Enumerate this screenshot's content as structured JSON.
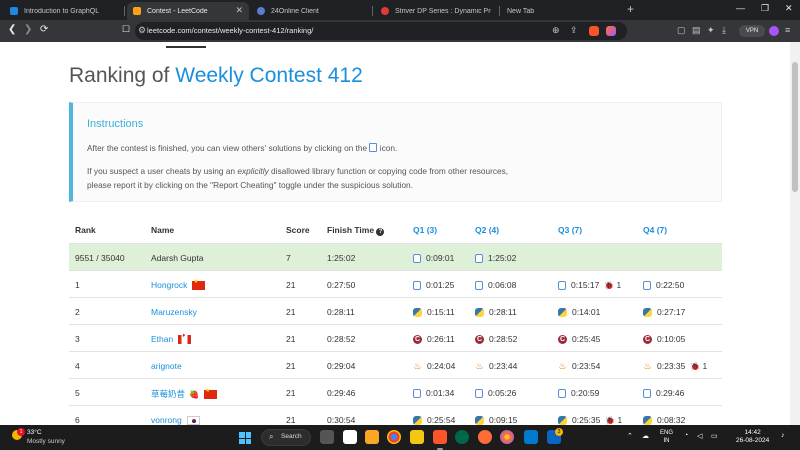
{
  "browser": {
    "tabs": [
      {
        "title": "Introduction to GraphQL",
        "color": "#1e88e5"
      },
      {
        "title": "Contest - LeetCode",
        "color": "#ffa116",
        "active": true
      },
      {
        "title": "24Online Client",
        "color": "#5b7bd5"
      },
      {
        "title": "Striver DP Series : Dynamic Program",
        "color": "#e53935"
      },
      {
        "title": "New Tab",
        "color": ""
      }
    ],
    "new_tab_symbol": "+",
    "window_controls": {
      "minimize": "—",
      "maximize": "❐",
      "close": "✕"
    },
    "url": "leetcode.com/contest/weekly-contest-412/ranking/",
    "vpn_label": "VPN"
  },
  "page": {
    "title_prefix": "Ranking of",
    "title_contest": "Weekly Contest 412"
  },
  "instructions": {
    "title": "Instructions",
    "line1_before": "After the contest is finished, you can view others' solutions by clicking on the",
    "line1_after": "icon.",
    "line2_before": "If you suspect a user cheats by using an",
    "line2_em": "explicitly",
    "line2_after": "disallowed library function or copying code from other resources,",
    "line3": "please report it by clicking on the \"Report Cheating\" toggle under the suspicious solution."
  },
  "table": {
    "headers": {
      "rank": "Rank",
      "name": "Name",
      "score": "Score",
      "finish_time": "Finish Time",
      "finish_time_help": "?",
      "q1": "Q1 (3)",
      "q2": "Q2 (4)",
      "q3": "Q3 (7)",
      "q4": "Q4 (7)"
    },
    "rows": [
      {
        "rank": "9551 / 35040",
        "name": "Adarsh Gupta",
        "name_link": false,
        "flag": "",
        "extra": "",
        "score": "7",
        "finish": "1:25:02",
        "q": [
          {
            "t": "0:09:01",
            "lang": "file",
            "bugs": ""
          },
          {
            "t": "1:25:02",
            "lang": "file",
            "bugs": ""
          },
          null,
          null
        ],
        "self": true
      },
      {
        "rank": "1",
        "name": "Hongrock",
        "name_link": true,
        "flag": "cn",
        "extra": "",
        "score": "21",
        "finish": "0:27:50",
        "q": [
          {
            "t": "0:01:25",
            "lang": "file",
            "bugs": ""
          },
          {
            "t": "0:06:08",
            "lang": "file",
            "bugs": ""
          },
          {
            "t": "0:15:17",
            "lang": "file",
            "bugs": "1"
          },
          {
            "t": "0:22:50",
            "lang": "file",
            "bugs": ""
          }
        ]
      },
      {
        "rank": "2",
        "name": "Maruzensky",
        "name_link": true,
        "flag": "",
        "extra": "",
        "score": "21",
        "finish": "0:28:11",
        "q": [
          {
            "t": "0:15:11",
            "lang": "py",
            "bugs": ""
          },
          {
            "t": "0:28:11",
            "lang": "py",
            "bugs": ""
          },
          {
            "t": "0:14:01",
            "lang": "py",
            "bugs": ""
          },
          {
            "t": "0:27:17",
            "lang": "py",
            "bugs": ""
          }
        ]
      },
      {
        "rank": "3",
        "name": "Ethan",
        "name_link": true,
        "flag": "ca",
        "extra": "",
        "score": "21",
        "finish": "0:28:52",
        "q": [
          {
            "t": "0:26:11",
            "lang": "cpp",
            "bugs": ""
          },
          {
            "t": "0:28:52",
            "lang": "cpp",
            "bugs": ""
          },
          {
            "t": "0:25:45",
            "lang": "cpp",
            "bugs": ""
          },
          {
            "t": "0:10:05",
            "lang": "cpp",
            "bugs": ""
          }
        ]
      },
      {
        "rank": "4",
        "name": "arignote",
        "name_link": true,
        "flag": "",
        "extra": "",
        "score": "21",
        "finish": "0:29:04",
        "q": [
          {
            "t": "0:24:04",
            "lang": "java",
            "bugs": ""
          },
          {
            "t": "0:23:44",
            "lang": "java",
            "bugs": ""
          },
          {
            "t": "0:23:54",
            "lang": "java",
            "bugs": ""
          },
          {
            "t": "0:23:35",
            "lang": "java",
            "bugs": "1"
          }
        ]
      },
      {
        "rank": "5",
        "name": "草莓奶昔",
        "name_link": true,
        "flag": "cn",
        "extra": "🍓",
        "score": "21",
        "finish": "0:29:46",
        "q": [
          {
            "t": "0:01:34",
            "lang": "file",
            "bugs": ""
          },
          {
            "t": "0:05:26",
            "lang": "file",
            "bugs": ""
          },
          {
            "t": "0:20:59",
            "lang": "file",
            "bugs": ""
          },
          {
            "t": "0:29:46",
            "lang": "file",
            "bugs": ""
          }
        ]
      },
      {
        "rank": "6",
        "name": "vonrong",
        "name_link": true,
        "flag": "kr",
        "extra": "",
        "score": "21",
        "finish": "0:30:54",
        "q": [
          {
            "t": "0:25:54",
            "lang": "py",
            "bugs": ""
          },
          {
            "t": "0:09:15",
            "lang": "py",
            "bugs": ""
          },
          {
            "t": "0:25:35",
            "lang": "py",
            "bugs": "1"
          },
          {
            "t": "0:08:32",
            "lang": "py",
            "bugs": ""
          }
        ]
      }
    ]
  },
  "taskbar": {
    "weather_temp": "33°C",
    "weather_desc": "Mostly sunny",
    "weather_badge": "1",
    "search_label": "Search",
    "lang_top": "ENG",
    "lang_bottom": "IN",
    "time": "14:42",
    "date": "26-08-2024",
    "app_badge": "3"
  }
}
